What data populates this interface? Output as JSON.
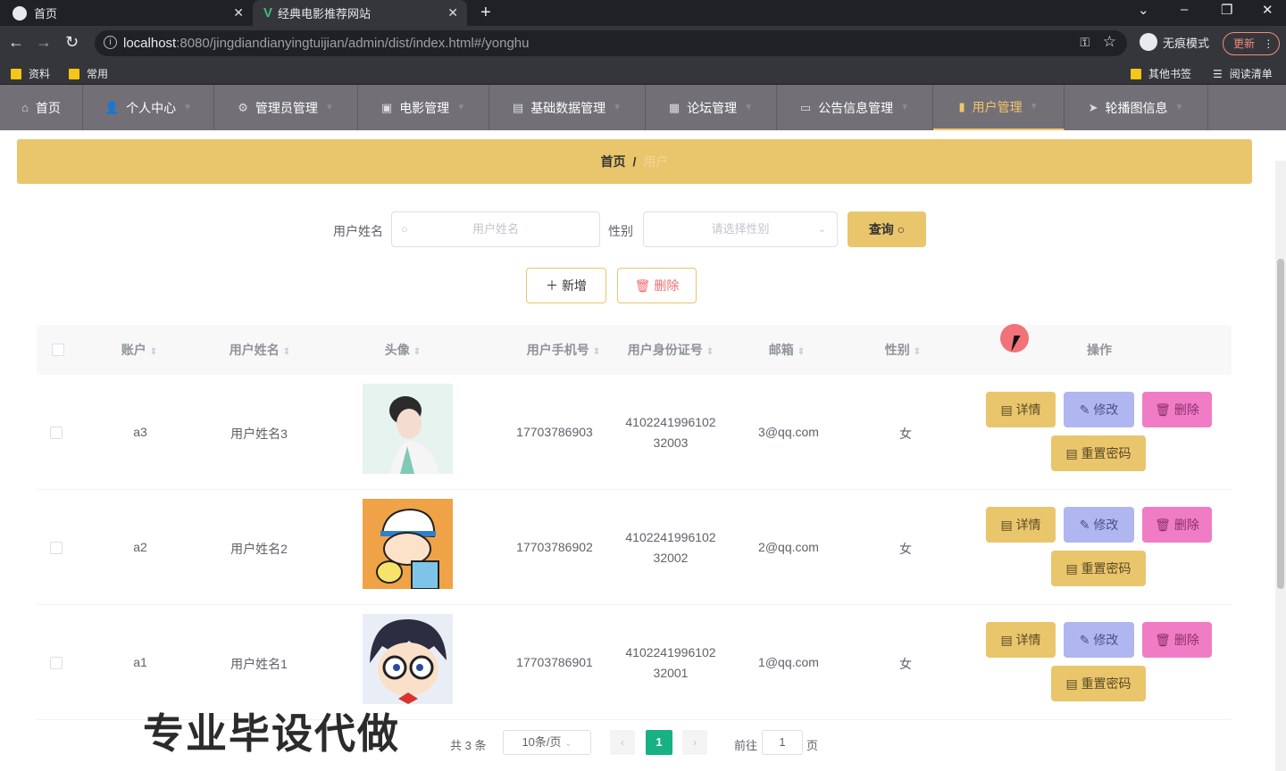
{
  "browser": {
    "tabs": [
      {
        "title": "首页"
      },
      {
        "title": "经典电影推荐网站"
      }
    ],
    "url_host": "localhost",
    "url_rest": ":8080/jingdiandianyingtuijian/admin/dist/index.html#/yonghu",
    "incognito_label": "无痕模式",
    "update_label": "更新",
    "bookmarks": [
      "资料",
      "常用"
    ],
    "bookmarks_right": [
      "其他书签",
      "阅读清单"
    ]
  },
  "nav": {
    "items": [
      "首页",
      "个人中心",
      "管理员管理",
      "电影管理",
      "基础数据管理",
      "论坛管理",
      "公告信息管理",
      "用户管理",
      "轮播图信息"
    ],
    "active_index": 7
  },
  "breadcrumb": {
    "home": "首页",
    "separator": "/",
    "current": "用户"
  },
  "search": {
    "name_label": "用户姓名",
    "name_placeholder": "用户姓名",
    "gender_label": "性别",
    "gender_placeholder": "请选择性别",
    "query_label": "查询"
  },
  "actions": {
    "add_label": "新增",
    "delete_label": "删除"
  },
  "table": {
    "columns": [
      "账户",
      "用户姓名",
      "头像",
      "用户手机号",
      "用户身份证号",
      "邮箱",
      "性别",
      "操作"
    ],
    "rows": [
      {
        "account": "a3",
        "name": "用户姓名3",
        "phone": "17703786903",
        "id_line1": "4102241996102",
        "id_line2": "32003",
        "email": "3@qq.com",
        "gender": "女"
      },
      {
        "account": "a2",
        "name": "用户姓名2",
        "phone": "17703786902",
        "id_line1": "4102241996102",
        "id_line2": "32002",
        "email": "2@qq.com",
        "gender": "女"
      },
      {
        "account": "a1",
        "name": "用户姓名1",
        "phone": "17703786901",
        "id_line1": "4102241996102",
        "id_line2": "32001",
        "email": "1@qq.com",
        "gender": "女"
      }
    ],
    "row_buttons": {
      "detail": "详情",
      "edit": "修改",
      "delete": "删除",
      "reset": "重置密码"
    }
  },
  "pagination": {
    "total": "共 3 条",
    "page_size": "10条/页",
    "current_page": "1",
    "goto_label": "前往",
    "goto_value": "1",
    "page_suffix": "页"
  },
  "watermark": "专业毕设代做",
  "colors": {
    "accent": "#e9c56c",
    "nav_bg": "#727076",
    "active_page": "#17b184",
    "edit_btn": "#b0b6f0",
    "delete_btn": "#f07cc5"
  }
}
